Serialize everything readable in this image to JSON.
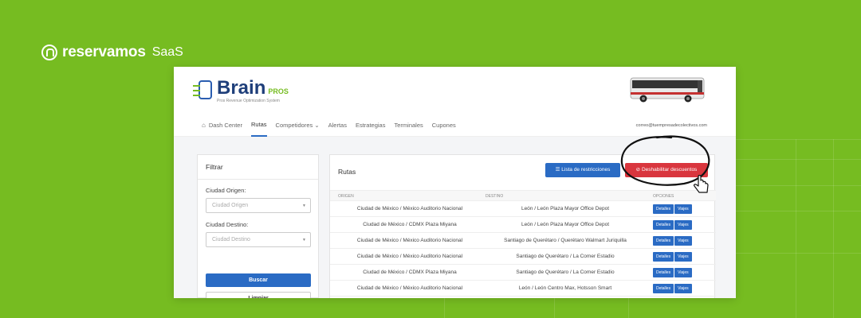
{
  "brand": {
    "name": "reservamos",
    "suffix": "SaaS"
  },
  "app": {
    "title": "Brain",
    "title_suffix": "PROS",
    "subtitle": "Pros Revenue Optimization System",
    "user_email": "correo@tuempresadecolectivos.com"
  },
  "nav": [
    {
      "label": "Dash Center",
      "active": false
    },
    {
      "label": "Rutas",
      "active": true
    },
    {
      "label": "Competidores ⌄",
      "active": false
    },
    {
      "label": "Alertas",
      "active": false
    },
    {
      "label": "Estrategias",
      "active": false
    },
    {
      "label": "Terminales",
      "active": false
    },
    {
      "label": "Cupones",
      "active": false
    }
  ],
  "filter": {
    "title": "Filtrar",
    "origin_label": "Ciudad Origen:",
    "origin_placeholder": "Ciudad Origen",
    "dest_label": "Ciudad Destino:",
    "dest_placeholder": "Ciudad Destino",
    "search_label": "Buscar",
    "clear_label": "Limpiar"
  },
  "routes": {
    "title": "Rutas",
    "restrictions_label": "Lista de restricciones",
    "disable_label": "Deshabilitar descuentos",
    "headers": {
      "origin": "ORIGEN",
      "destination": "DESTINO",
      "options": "OPCIONES"
    },
    "details_label": "Detalles",
    "trips_label": "Viajes",
    "rows": [
      {
        "origin": "Ciudad de México / México Auditorio Nacional",
        "destination": "León / León Plaza Mayor Office Depot"
      },
      {
        "origin": "Ciudad de México / CDMX Plaza Miyana",
        "destination": "León / León Plaza Mayor Office Depot"
      },
      {
        "origin": "Ciudad de México / México Auditorio Nacional",
        "destination": "Santiago de Querétaro / Querétaro Walmart Juriquilla"
      },
      {
        "origin": "Ciudad de México / México Auditorio Nacional",
        "destination": "Santiago de Querétaro / La Comer Estadio"
      },
      {
        "origin": "Ciudad de México / CDMX Plaza Miyana",
        "destination": "Santiago de Querétaro / La Comer Estadio"
      },
      {
        "origin": "Ciudad de México / México Auditorio Nacional",
        "destination": "León / León Centro Max, Hotsson Smart"
      }
    ]
  },
  "colors": {
    "background": "#76bc21",
    "primary": "#2a6bc4",
    "danger": "#d9363e",
    "logo_blue": "#1f3f7a"
  },
  "icons": {
    "home": "home-icon",
    "list": "list-icon",
    "ban": "ban-icon",
    "cursor": "hand-cursor-icon"
  }
}
